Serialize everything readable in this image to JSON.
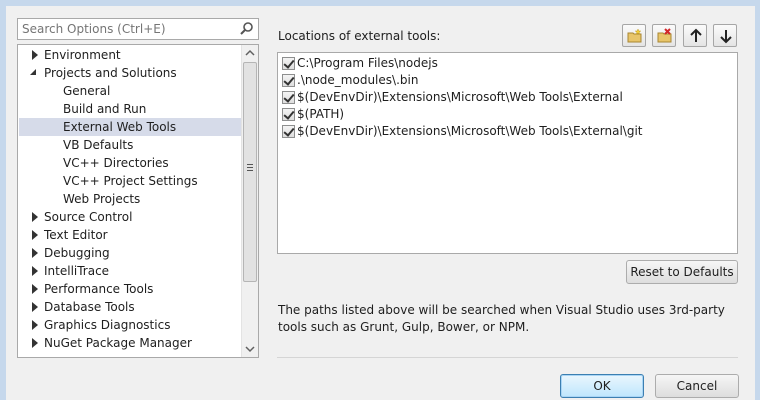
{
  "search": {
    "placeholder": "Search Options (Ctrl+E)"
  },
  "tree": {
    "items": [
      {
        "label": "Environment",
        "level": 0,
        "state": "collapsed"
      },
      {
        "label": "Projects and Solutions",
        "level": 0,
        "state": "expanded"
      },
      {
        "label": "General",
        "level": 1
      },
      {
        "label": "Build and Run",
        "level": 1
      },
      {
        "label": "External Web Tools",
        "level": 1,
        "selected": true
      },
      {
        "label": "VB Defaults",
        "level": 1
      },
      {
        "label": "VC++ Directories",
        "level": 1
      },
      {
        "label": "VC++ Project Settings",
        "level": 1
      },
      {
        "label": "Web Projects",
        "level": 1
      },
      {
        "label": "Source Control",
        "level": 0,
        "state": "collapsed"
      },
      {
        "label": "Text Editor",
        "level": 0,
        "state": "collapsed"
      },
      {
        "label": "Debugging",
        "level": 0,
        "state": "collapsed"
      },
      {
        "label": "IntelliTrace",
        "level": 0,
        "state": "collapsed"
      },
      {
        "label": "Performance Tools",
        "level": 0,
        "state": "collapsed"
      },
      {
        "label": "Database Tools",
        "level": 0,
        "state": "collapsed"
      },
      {
        "label": "Graphics Diagnostics",
        "level": 0,
        "state": "collapsed"
      },
      {
        "label": "NuGet Package Manager",
        "level": 0,
        "state": "collapsed"
      }
    ]
  },
  "locations": {
    "label": "Locations of external tools:",
    "toolbar_icons": [
      "add-folder-icon",
      "delete-folder-icon",
      "arrow-up-icon",
      "arrow-down-icon"
    ],
    "paths": [
      {
        "text": "C:\\Program Files\\nodejs",
        "checked": true
      },
      {
        "text": ".\\node_modules\\.bin",
        "checked": true
      },
      {
        "text": "$(DevEnvDir)\\Extensions\\Microsoft\\Web Tools\\External",
        "checked": true
      },
      {
        "text": "$(PATH)",
        "checked": true
      },
      {
        "text": "$(DevEnvDir)\\Extensions\\Microsoft\\Web Tools\\External\\git",
        "checked": true
      }
    ]
  },
  "reset_label": "Reset to Defaults",
  "description": "The paths listed above will be searched when Visual Studio uses 3rd-party tools such as Grunt, Gulp, Bower, or NPM.",
  "footer": {
    "ok_label": "OK",
    "cancel_label": "Cancel"
  },
  "colors": {
    "selection": "#d6dbe9",
    "frame": "#c6d8ec"
  }
}
